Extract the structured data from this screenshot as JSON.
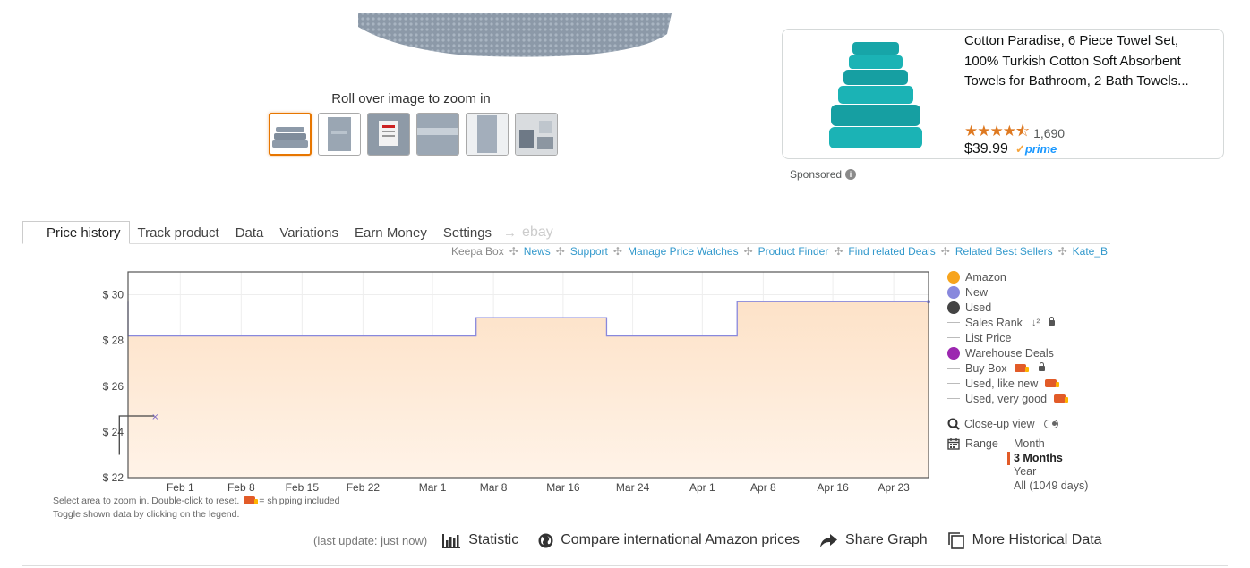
{
  "product": {
    "zoom_hint": "Roll over image to zoom in",
    "thumbnails": [
      "towel-stack-thumb",
      "towel-folded-thumb",
      "label-thumb",
      "towel-closeup-thumb",
      "towel-hanging-thumb",
      "bathroom-thumb"
    ]
  },
  "sponsored_ad": {
    "title": "Cotton Paradise, 6 Piece Towel Set, 100% Turkish Cotton Soft Absorbent Towels for Bathroom, 2 Bath Towels...",
    "stars": "★★★★⯪",
    "rating_count": "1,690",
    "price": "$39.99",
    "prime_check": "✓",
    "prime_label": "prime",
    "sponsored_label": "Sponsored"
  },
  "keepa": {
    "tabs": [
      "Price history",
      "Track product",
      "Data",
      "Variations",
      "Earn Money",
      "Settings"
    ],
    "tab_arrow": "→",
    "tab_ebay": "ebay",
    "links": [
      "Keepa Box",
      "News",
      "Support",
      "Manage Price Watches",
      "Product Finder",
      "Find related Deals",
      "Related Best Sellers",
      "Kate_B"
    ],
    "link_separator": "✣",
    "help_line1": "Select area to zoom in. Double-click to reset.",
    "help_shipping": "= shipping included",
    "help_line2": "Toggle shown data by clicking on the legend.",
    "legend": {
      "amazon": "Amazon",
      "new": "New",
      "used": "Used",
      "sales_rank": "Sales Rank",
      "sales_rank_sort": "↓²",
      "list_price": "List Price",
      "warehouse": "Warehouse Deals",
      "buy_box": "Buy Box",
      "used_like_new": "Used, like new",
      "used_very_good": "Used, very good"
    },
    "legend_colors": {
      "amazon": "#f7a41d",
      "new": "#8888dd",
      "used": "#444444",
      "warehouse": "#9c27b0"
    },
    "closeup_label": "Close-up view",
    "range_label": "Range",
    "range_options": [
      "Month",
      "3 Months",
      "Year",
      "All (1049 days)"
    ],
    "range_selected": "3 Months",
    "footer": {
      "last_update": "(last update: just now)",
      "statistic": "Statistic",
      "compare": "Compare international Amazon prices",
      "share": "Share Graph",
      "more": "More Historical Data"
    }
  },
  "chart_data": {
    "type": "line",
    "title": "",
    "xlabel": "",
    "ylabel": "",
    "x_ticks": [
      "Feb 1",
      "Feb 8",
      "Feb 15",
      "Feb 22",
      "Mar 1",
      "Mar 8",
      "Mar 16",
      "Mar 24",
      "Apr 1",
      "Apr 8",
      "Apr 16",
      "Apr 23"
    ],
    "y_ticks": [
      "$ 30",
      "$ 28",
      "$ 26",
      "$ 24",
      "$ 22"
    ],
    "ylim": [
      22,
      31
    ],
    "xlim": [
      "2024-01-26",
      "2024-04-27"
    ],
    "grid": true,
    "series": [
      {
        "name": "New",
        "color": "#8888dd",
        "fill": true,
        "points": [
          [
            "2024-01-26",
            29.7
          ],
          [
            "2024-01-26",
            28.2
          ],
          [
            "2024-03-06",
            28.2
          ],
          [
            "2024-03-06",
            29.0
          ],
          [
            "2024-03-21",
            29.0
          ],
          [
            "2024-03-21",
            28.2
          ],
          [
            "2024-04-05",
            28.2
          ],
          [
            "2024-04-05",
            29.7
          ],
          [
            "2024-04-27",
            29.7
          ]
        ]
      },
      {
        "name": "Used",
        "color": "#444444",
        "fill": false,
        "points": [
          [
            "2024-01-25",
            23.0
          ],
          [
            "2024-01-25",
            24.7
          ],
          [
            "2024-01-29",
            24.7
          ]
        ]
      }
    ]
  }
}
